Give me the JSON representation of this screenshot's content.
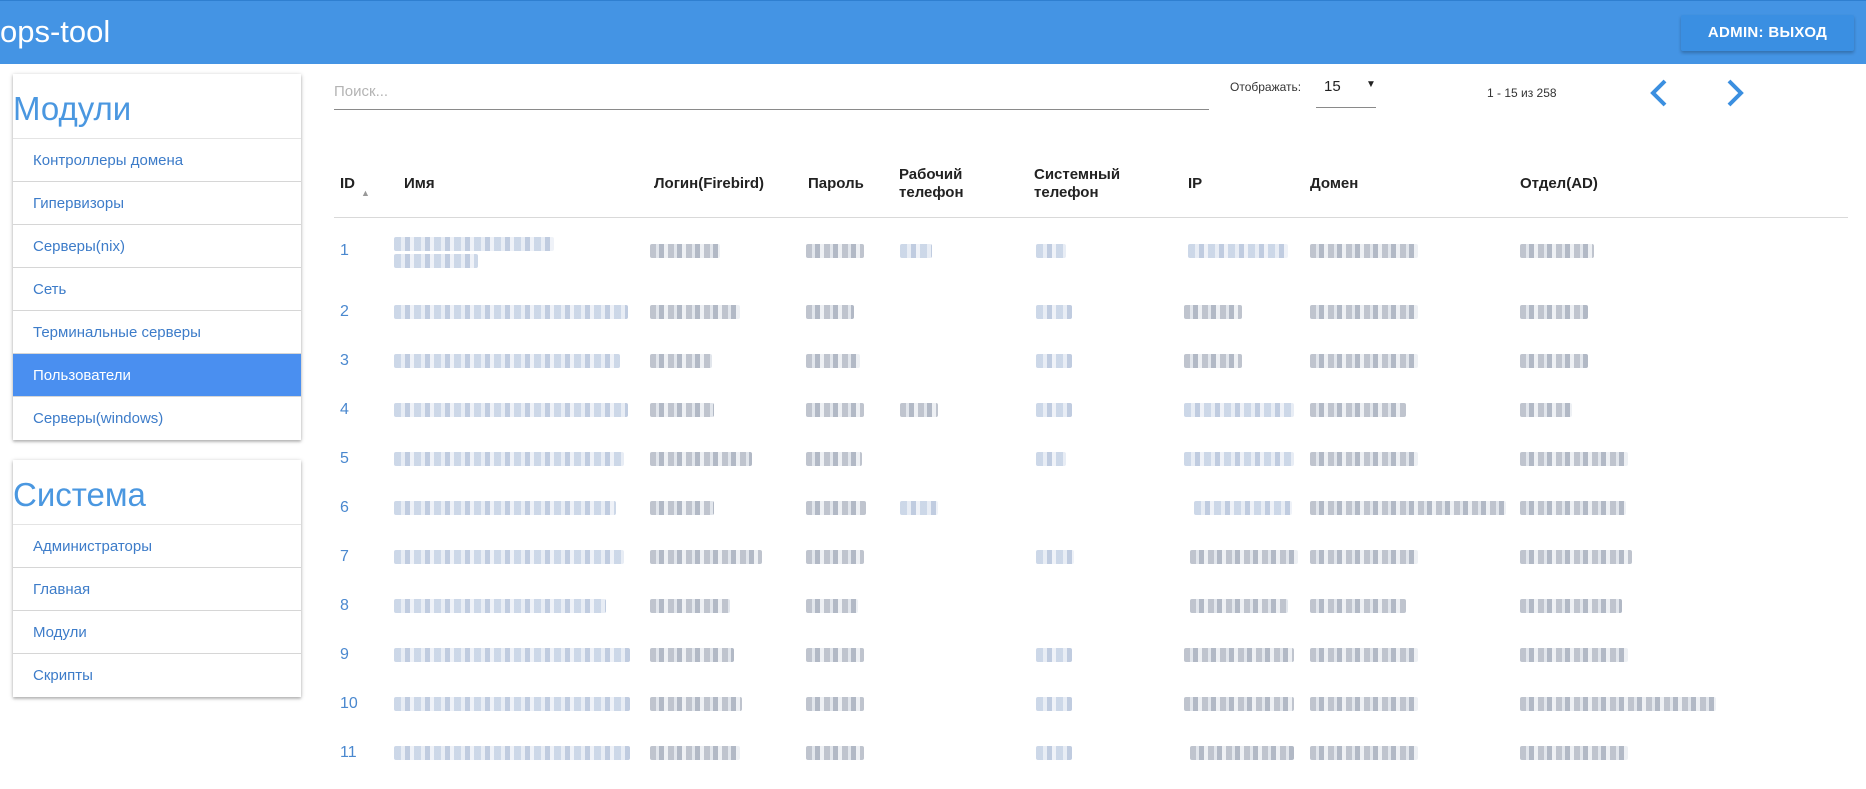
{
  "app": {
    "title": "ops-tool",
    "logout_label": "ADMIN: ВЫХОД"
  },
  "sidebar": {
    "modules_title": "Модули",
    "modules": [
      {
        "label": "Контроллеры домена"
      },
      {
        "label": "Гипервизоры"
      },
      {
        "label": "Серверы(nix)"
      },
      {
        "label": "Сеть"
      },
      {
        "label": "Терминальные серверы"
      },
      {
        "label": "Пользователи",
        "active": true
      },
      {
        "label": "Серверы(windows)"
      }
    ],
    "system_title": "Система",
    "system": [
      {
        "label": "Администраторы"
      },
      {
        "label": "Главная"
      },
      {
        "label": "Модули"
      },
      {
        "label": "Скрипты"
      }
    ]
  },
  "toolbar": {
    "search_placeholder": "Поиск...",
    "show_label": "Отображать:",
    "per_page": "15",
    "range": "1 - 15 из 258"
  },
  "table": {
    "headers": {
      "id": "ID",
      "name": "Имя",
      "login": "Логин(Firebird)",
      "password": "Пароль",
      "work_phone_1": "Рабочий",
      "work_phone_2": "телефон",
      "sys_phone_1": "Системный",
      "sys_phone_2": "телефон",
      "ip": "IP",
      "domain": "Домен",
      "department": "Отдел(AD)"
    },
    "sort_column": "ID",
    "sort_direction": "ascending",
    "row_ids": [
      "1",
      "2",
      "3",
      "4",
      "5",
      "6",
      "7",
      "8",
      "9",
      "10",
      "11"
    ],
    "cell_content": "redacted (pixelated in screenshot)"
  },
  "colors": {
    "topbar": "#4494e4",
    "accent": "#4a97e0",
    "active_item": "#4a8ff0",
    "link": "#3d7cc9"
  },
  "icons": {
    "prev": "chevron-left-icon",
    "next": "chevron-right-icon",
    "sort": "sort-up-icon",
    "dropdown": "caret-down-icon"
  }
}
